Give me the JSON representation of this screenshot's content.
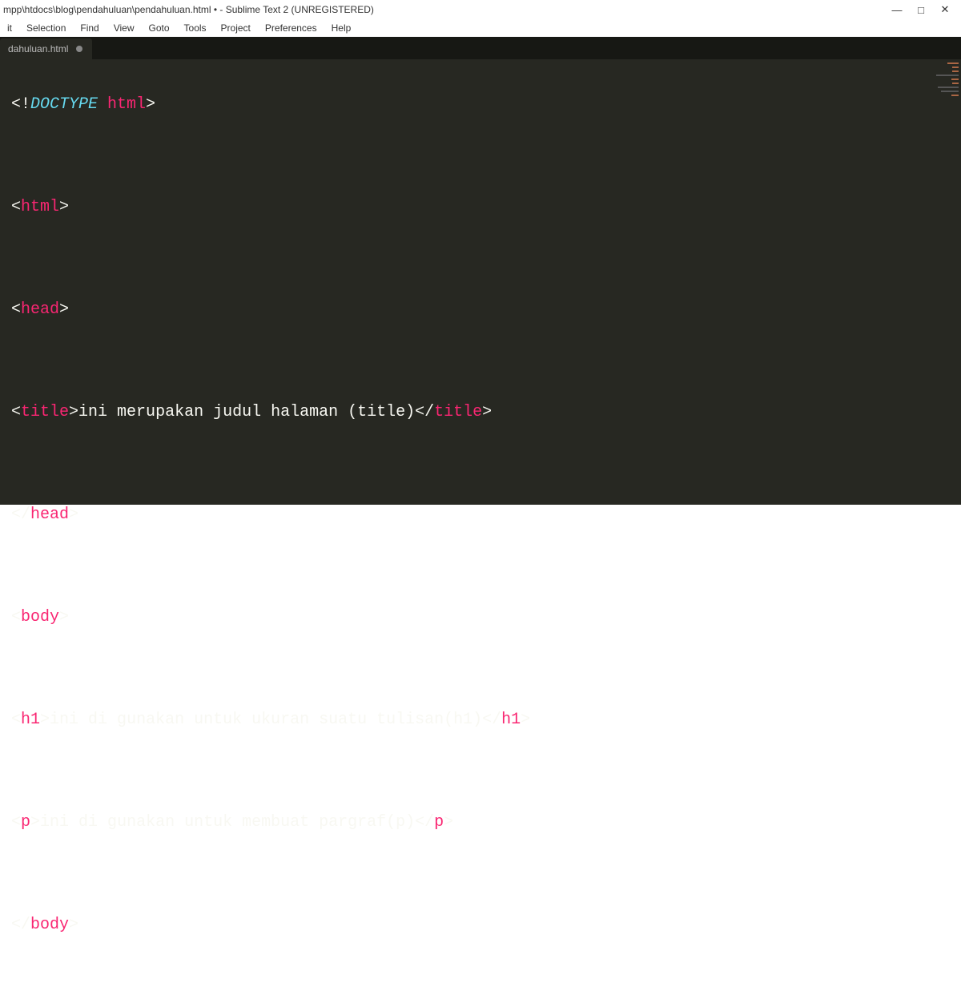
{
  "titlebar": {
    "path": "mpp\\htdocs\\blog\\pendahuluan\\pendahuluan.html • - Sublime Text 2 (UNREGISTERED)"
  },
  "menu": {
    "items": [
      "it",
      "Selection",
      "Find",
      "View",
      "Goto",
      "Tools",
      "Project",
      "Preferences",
      "Help"
    ]
  },
  "tab": {
    "name": "dahuluan.html"
  },
  "code": {
    "l1_a": "<!",
    "l1_b": "DOCTYPE ",
    "l1_c": "html",
    "l1_d": ">",
    "l2_a": "<",
    "l2_b": "html",
    "l2_c": ">",
    "l3_a": "<",
    "l3_b": "head",
    "l3_c": ">",
    "l4_a": "<",
    "l4_b": "title",
    "l4_c": ">",
    "l4_d": "ini merupakan judul halaman (title)",
    "l4_e": "</",
    "l4_f": "title",
    "l4_g": ">",
    "l5_a": "</",
    "l5_b": "head",
    "l5_c": ">",
    "l6_a": "<",
    "l6_b": "body",
    "l6_c": ">",
    "l7_a": "<",
    "l7_b": "h1",
    "l7_c": ">",
    "l7_d": "ini di gunakan untuk ukuran suatu tulisan(h1)",
    "l7_e": "</",
    "l7_f": "h1",
    "l7_g": ">",
    "l8_a": "<",
    "l8_b": "p",
    "l8_c": ">",
    "l8_d": "ini di gunakan untuk membuat pargraf(p)",
    "l8_e": "</",
    "l8_f": "p",
    "l8_g": ">",
    "l9_a": "</",
    "l9_b": "body",
    "l9_c": ">"
  }
}
